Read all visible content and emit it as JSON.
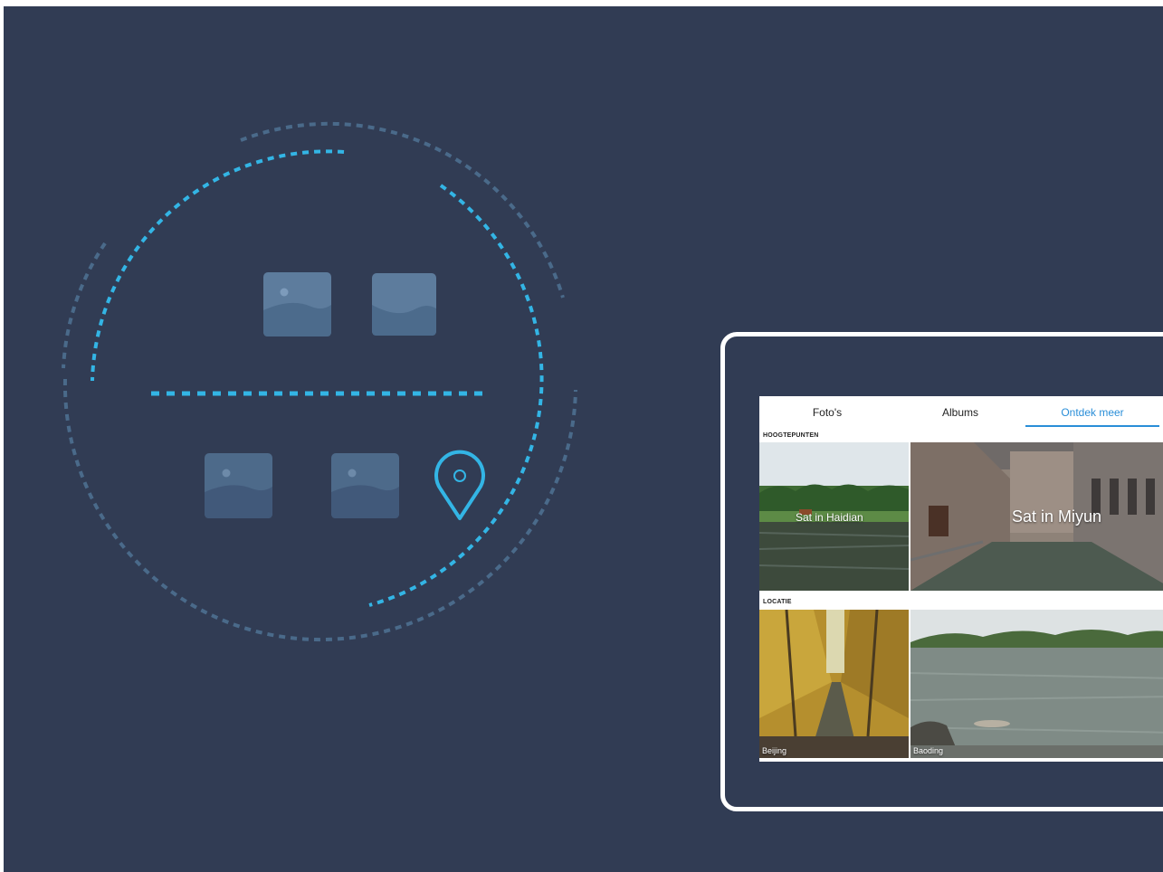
{
  "colors": {
    "background": "#313c54",
    "accent": "#33b5e5",
    "ring_dim": "#4a6a8a",
    "image_tile": "#5d7c9d",
    "tab_active": "#2a8ed8",
    "tablet_frame": "#ffffff"
  },
  "illustration": {
    "icons": [
      "image-icon",
      "image-icon",
      "image-icon",
      "image-icon",
      "location-pin-icon"
    ]
  },
  "gallery": {
    "tabs": [
      {
        "label": "Foto's",
        "active": false
      },
      {
        "label": "Albums",
        "active": false
      },
      {
        "label": "Ontdek meer",
        "active": true
      }
    ],
    "sections": {
      "highlights": {
        "title": "HOOGTEPUNTEN",
        "items": [
          {
            "caption": "Sat in Haidian"
          },
          {
            "caption": "Sat in Miyun"
          }
        ]
      },
      "location": {
        "title": "LOCATIE",
        "items": [
          {
            "caption": "Beijing"
          },
          {
            "caption": "Baoding"
          }
        ]
      }
    }
  }
}
